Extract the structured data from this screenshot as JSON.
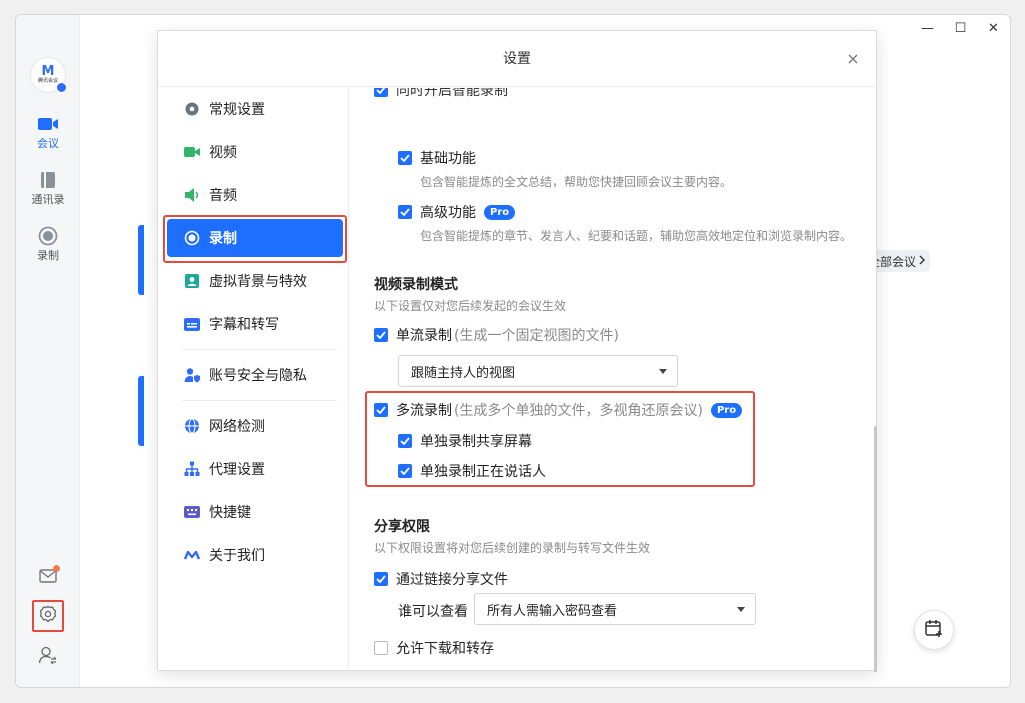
{
  "app": {
    "logo_text": "M",
    "logo_sub": "腾讯会议",
    "rail": [
      {
        "label": "会议",
        "icon": "video-camera-icon"
      },
      {
        "label": "通讯录",
        "icon": "contacts-book-icon"
      },
      {
        "label": "录制",
        "icon": "record-circle-icon"
      }
    ],
    "bottom_icons": [
      "mail-icon",
      "settings-gear-icon",
      "user-switch-icon"
    ],
    "all_meetings": "全部会议",
    "window_controls": {
      "minimize": "—",
      "maximize": "☐",
      "close": "✕"
    }
  },
  "dialog": {
    "title": "设置",
    "close": "×",
    "nav": [
      {
        "label": "常规设置",
        "icon": "gear-icon"
      },
      {
        "label": "视频",
        "icon": "video-icon"
      },
      {
        "label": "音频",
        "icon": "speaker-icon"
      },
      {
        "label": "录制",
        "icon": "record-icon"
      },
      {
        "label": "虚拟背景与特效",
        "icon": "virtual-background-icon"
      },
      {
        "label": "字幕和转写",
        "icon": "subtitle-icon"
      },
      {
        "label": "账号安全与隐私",
        "icon": "account-security-icon"
      },
      {
        "label": "网络检测",
        "icon": "globe-icon"
      },
      {
        "label": "代理设置",
        "icon": "proxy-network-icon"
      },
      {
        "label": "快捷键",
        "icon": "keyboard-icon"
      },
      {
        "label": "关于我们",
        "icon": "about-logo-icon"
      }
    ],
    "active_nav": "录制"
  },
  "content": {
    "partial_top": "同时开启智能录制",
    "basic": {
      "label": "基础功能",
      "desc": "包含智能提炼的全文总结，帮助您快捷回顾会议主要内容。",
      "checked": true
    },
    "advanced": {
      "label": "高级功能",
      "badge": "Pro",
      "desc": "包含智能提炼的章节、发言人、纪要和话题，辅助您高效地定位和浏览录制内容。",
      "checked": true
    },
    "video_mode": {
      "title": "视频录制模式",
      "subtitle": "以下设置仅对您后续发起的会议生效",
      "single": {
        "label": "单流录制",
        "hint": "(生成一个固定视图的文件)",
        "checked": true
      },
      "view_select": "跟随主持人的视图",
      "multi": {
        "label": "多流录制",
        "hint": "(生成多个单独的文件，多视角还原会议)",
        "badge": "Pro",
        "checked": true
      },
      "multi_share": {
        "label": "单独录制共享屏幕",
        "checked": true
      },
      "multi_speaker": {
        "label": "单独录制正在说话人",
        "checked": true
      }
    },
    "share": {
      "title": "分享权限",
      "subtitle": "以下权限设置将对您后续创建的录制与转写文件生效",
      "link_share": {
        "label": "通过链接分享文件",
        "checked": true
      },
      "who_label": "谁可以查看",
      "who_select": "所有人需输入密码查看",
      "download": {
        "label": "允许下载和转存",
        "checked": false
      }
    }
  },
  "colors": {
    "accent": "#1e6fff",
    "highlight": "#e34d3f"
  }
}
